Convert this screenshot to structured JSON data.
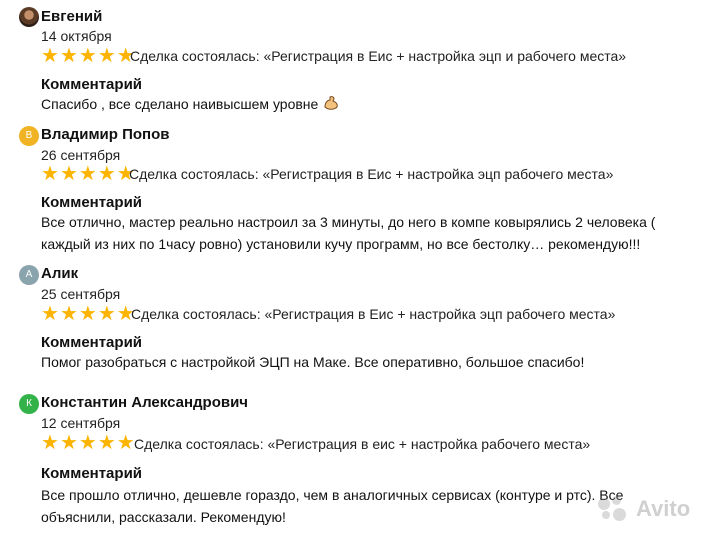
{
  "reviews": [
    {
      "name": "Евгений",
      "avatar_letter": "",
      "avatar_color": "#5a3a25",
      "date": "14 октября",
      "rating": 5,
      "deal": "Сделка состоялась: «Регистрация в Еис + настройка эцп и рабочего места»",
      "comment_title": "Комментарий",
      "comment": "Спасибо , все сделано наивысшем уровне",
      "comment_emoji": "muscle-emoji"
    },
    {
      "name": "Владимир Попов",
      "avatar_letter": "В",
      "avatar_color": "#f0b323",
      "date": "26 сентября",
      "rating": 5,
      "deal": "Сделка состоялась: «Регистрация в Еис + настройка эцп рабочего места»",
      "comment_title": "Комментарий",
      "comment": "Все отлично, мастер реально настроил за 3 минуты, до него в компе ковырялись 2 человека ( каждый из них по 1часу ровно) установили кучу программ, но все бестолку… рекомендую!!!"
    },
    {
      "name": "Алик",
      "avatar_letter": "А",
      "avatar_color": "#8aa4ad",
      "date": "25 сентября",
      "rating": 5,
      "deal": "Сделка состоялась: «Регистрация в Еис + настройка эцп рабочего места»",
      "comment_title": "Комментарий",
      "comment": "Помог разобраться с настройкой ЭЦП на Маке. Все оперативно, большое спасибо!"
    },
    {
      "name": "Константин Александрович",
      "avatar_letter": "К",
      "avatar_color": "#33b24a",
      "date": "12 сентября",
      "rating": 5,
      "deal": "Сделка состоялась: «Регистрация в еис + настройка рабочего места»",
      "comment_title": "Комментарий",
      "comment": "Все прошло отлично, дешевле гораздо, чем в аналогичных сервисах (контуре и ртс). Все объяснили, рассказали. Рекомендую!"
    }
  ],
  "watermark": {
    "text": "Avito"
  }
}
